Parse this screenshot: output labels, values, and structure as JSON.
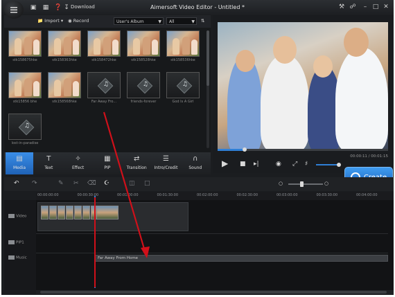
{
  "app": {
    "title": "Aimersoft Video Editor - Untitled *",
    "download_label": "Download"
  },
  "library": {
    "import_label": "Import",
    "record_label": "Record",
    "album_select": "User's Album",
    "filter_select": "All",
    "items": [
      {
        "type": "photo",
        "caption": "stk158675hke"
      },
      {
        "type": "photo",
        "caption": "stk158363hke"
      },
      {
        "type": "photo",
        "caption": "stk158472hke"
      },
      {
        "type": "photo",
        "caption": "stk158528hke"
      },
      {
        "type": "photo",
        "caption": "stk158536hke"
      },
      {
        "type": "photo",
        "caption": "stk15856 bhe"
      },
      {
        "type": "photo",
        "caption": "stk158568hke"
      },
      {
        "type": "music",
        "caption": "Far Away Fro..."
      },
      {
        "type": "music",
        "caption": "friends-forever"
      },
      {
        "type": "music",
        "caption": "God Is A Girl"
      },
      {
        "type": "music",
        "caption": "lost-in-paradise"
      }
    ]
  },
  "tools": [
    {
      "label": "Media",
      "icon": "media-icon",
      "active": true
    },
    {
      "label": "Text",
      "icon": "text-icon",
      "active": false
    },
    {
      "label": "Effect",
      "icon": "effect-wand-icon",
      "active": false
    },
    {
      "label": "PIP",
      "icon": "pip-icon",
      "active": false
    },
    {
      "label": "Transition",
      "icon": "transition-icon",
      "active": false
    },
    {
      "label": "Intro/Credit",
      "icon": "intro-credit-icon",
      "active": false
    },
    {
      "label": "Sound",
      "icon": "headphones-icon",
      "active": false
    }
  ],
  "preview": {
    "time": "00:00:11 / 00:01:15",
    "progress": 0.16,
    "volume": 0.85
  },
  "create_label": "Create",
  "timeline": {
    "ticks": [
      "00:00:00:00",
      "00:00:30:00",
      "00:01:00:00",
      "00:01:30:00",
      "00:02:00:00",
      "00:02:30:00",
      "00:03:00:00",
      "00:03:30:00",
      "00:04:00:00"
    ],
    "tracks": [
      {
        "label": "Video",
        "icon": "video-track-icon"
      },
      {
        "label": "PIP1",
        "icon": "pip-track-icon"
      },
      {
        "label": "Music",
        "icon": "music-note-icon"
      }
    ],
    "music_clip": "Far Away From Home"
  },
  "colors": {
    "accent": "#2f7fd6",
    "annotation": "#d0101a",
    "background": "#1b1d20"
  }
}
